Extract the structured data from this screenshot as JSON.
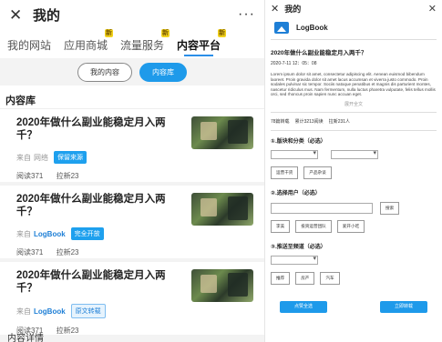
{
  "left": {
    "header": {
      "title": "我的",
      "more_label": "···"
    },
    "tabs": [
      {
        "label": "我的网站",
        "badge": ""
      },
      {
        "label": "应用商城",
        "badge": "新"
      },
      {
        "label": "流量服务",
        "badge": "新"
      },
      {
        "label": "内容平台",
        "badge": "新"
      }
    ],
    "segments": [
      {
        "label": "我的内容"
      },
      {
        "label": "内容库"
      }
    ],
    "section_title": "内容库",
    "cards": [
      {
        "title": "2020年做什么副业能稳定月入两千？",
        "from_label": "来自",
        "source": "网络",
        "tag": "保留来源",
        "reads": "阅读371",
        "pulls": "拉新23"
      },
      {
        "title": "2020年做什么副业能稳定月入两千？",
        "from_label": "来自",
        "source": "LogBook",
        "tag": "完全开放",
        "reads": "阅读371",
        "pulls": "拉新23"
      },
      {
        "title": "2020年做什么副业能稳定月入两千？",
        "from_label": "来自",
        "source": "LogBook",
        "tag": "原文转载",
        "reads": "阅读371",
        "pulls": "拉新23"
      }
    ],
    "bottom_text": "内容详情"
  },
  "right": {
    "header": {
      "title": "我的"
    },
    "brand_name": "LogBook",
    "article_title": "2020年做什么副业能稳定月入两千？",
    "date": "2020-7-11 12：05：08",
    "lorem": "Lorem ipsum dolor sit amet, consectetur adipiscing elit. Aenean euismod bibendum laoreet. Proin gravida dolor sit amet lacus accumsan et viverra justo commodo. Proin sodales pulvinar sic tempor. Sociis natoque penatibus et magnis dis parturient montes, nascetur ridiculus mus. Nam fermentum, nulla luctus pharetra vulputate, felis tellus mollis orci, sed rhoncus proin sapien nunc accuan eget.",
    "expand": "展开全文",
    "stats": [
      "78篇转载",
      "累计3213阅读",
      "拉新231人"
    ],
    "step1": "①.版块和分类（必选）",
    "step1_buttons": [
      "运营干货",
      "产品杂谈"
    ],
    "step2": "②.选择用户（必选）",
    "search_button": "搜索",
    "step2_buttons": [
      "李美",
      "投资运营团队",
      "爱开小吃"
    ],
    "step3": "③.推送至频道（必选）",
    "step3_buttons": [
      "推荐",
      "房产",
      "汽车"
    ],
    "actions": [
      "点赞全选",
      "立即转载"
    ]
  }
}
